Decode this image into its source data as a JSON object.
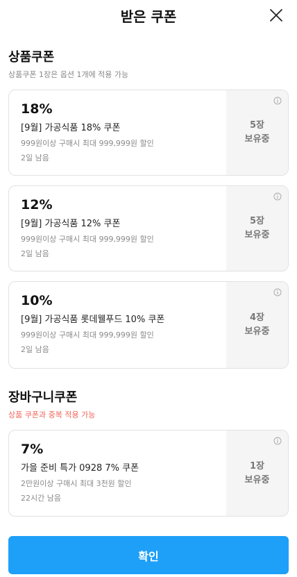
{
  "header": {
    "title": "받은 쿠폰"
  },
  "product_section": {
    "title": "상품쿠폰",
    "subtitle": "상품쿠폰 1장은 옵션 1개에 적용 가능",
    "coupons": [
      {
        "rate": "18%",
        "name": "[9월] 가공식품 18% 쿠폰",
        "condition": "999원이상 구매시 최대 999,999원 할인",
        "remaining": "2일 남음",
        "count_line1": "5장",
        "count_line2": "보유중"
      },
      {
        "rate": "12%",
        "name": "[9월] 가공식품 12% 쿠폰",
        "condition": "999원이상 구매시 최대 999,999원 할인",
        "remaining": "2일 남음",
        "count_line1": "5장",
        "count_line2": "보유중"
      },
      {
        "rate": "10%",
        "name": "[9월] 가공식품 롯데웰푸드 10% 쿠폰",
        "condition": "999원이상 구매시 최대 999,999원 할인",
        "remaining": "2일 남음",
        "count_line1": "4장",
        "count_line2": "보유중"
      }
    ]
  },
  "cart_section": {
    "title": "장바구니쿠폰",
    "subtitle": "상품 쿠폰과 중복 적용 가능",
    "coupons": [
      {
        "rate": "7%",
        "name": "가을 준비 특가 0928 7% 쿠폰",
        "condition": "2만원이상 구매시 최대 3천원 할인",
        "remaining": "22시간 남음",
        "count_line1": "1장",
        "count_line2": "보유중"
      }
    ]
  },
  "confirm_button": {
    "label": "확인"
  },
  "colors": {
    "accent": "#1e9ff8",
    "warning": "#f2655a"
  }
}
